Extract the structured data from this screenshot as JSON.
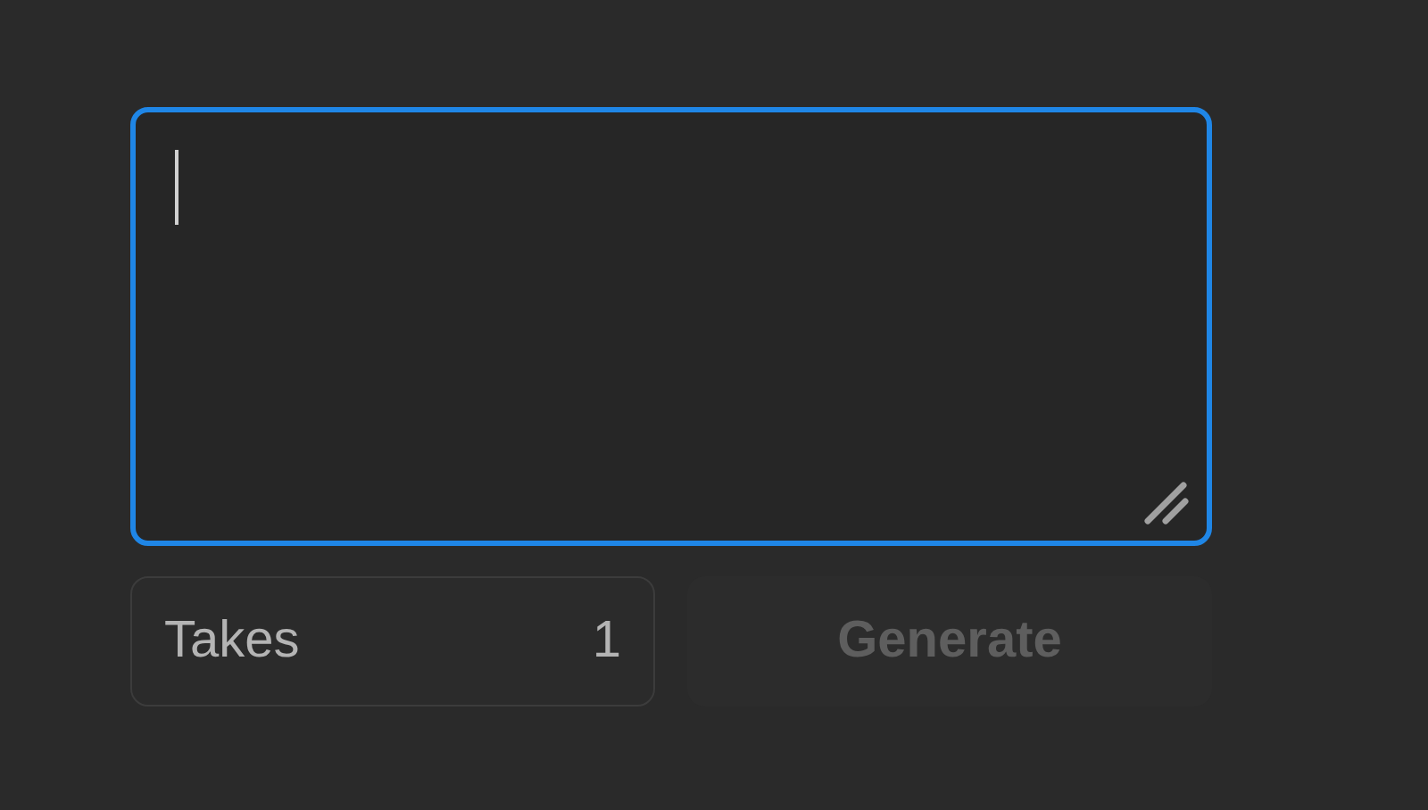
{
  "prompt": {
    "focused": true
  },
  "takes": {
    "label": "Takes",
    "value": "1"
  },
  "generate": {
    "label": "Generate",
    "disabled": true
  }
}
